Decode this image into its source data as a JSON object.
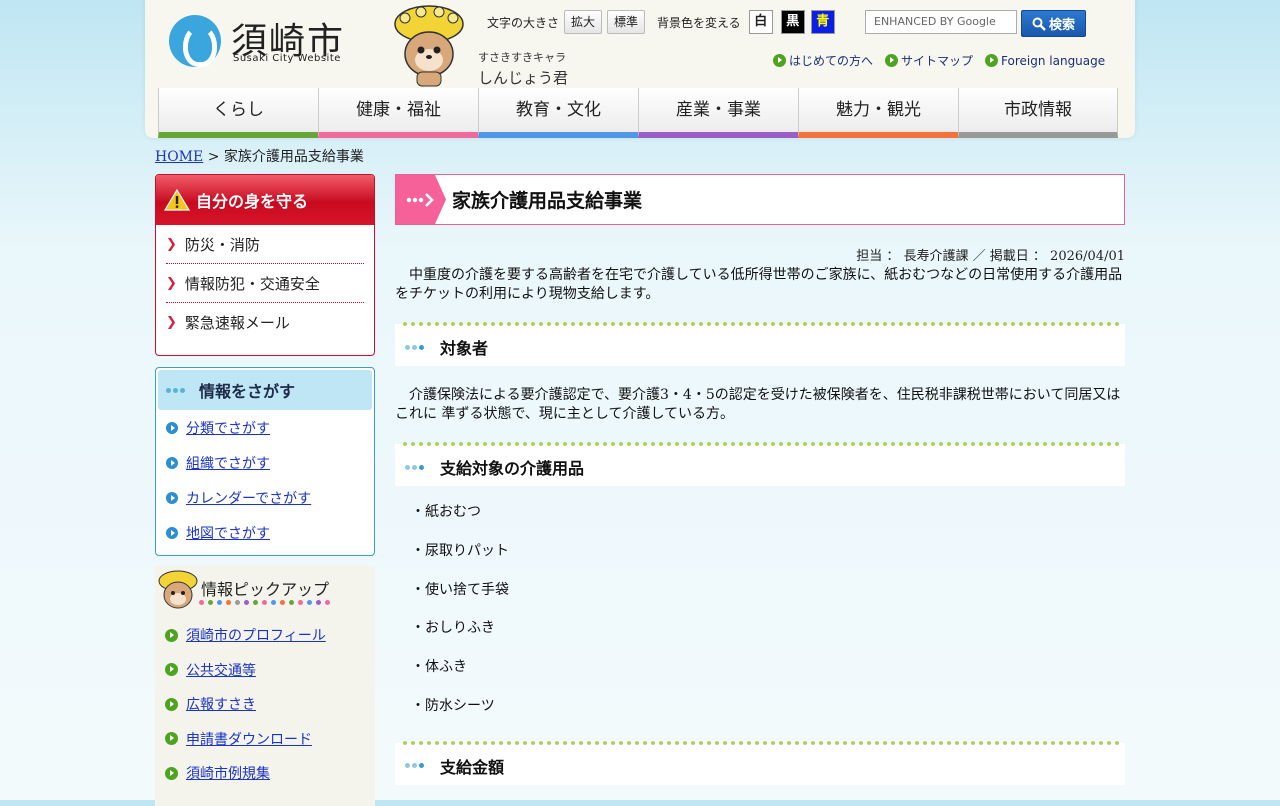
{
  "header": {
    "logo_text": "須崎市",
    "logo_sub": "Susaki City Website",
    "mascot_sub": "すさきすきキャラ",
    "mascot_name": "しんじょう君",
    "font_size_label": "文字の大きさ",
    "font_enlarge": "拡大",
    "font_standard": "標準",
    "bg_color_label": "背景色を変える",
    "bg_white": "白",
    "bg_black": "黒",
    "bg_blue": "青",
    "search_placeholder": "ENHANCED BY Google",
    "search_button": "検索",
    "sublinks": [
      "はじめての方へ",
      "サイトマップ",
      "Foreign language"
    ]
  },
  "nav": [
    {
      "label": "くらし",
      "color": "#66a638"
    },
    {
      "label": "健康・福祉",
      "color": "#f26a9c"
    },
    {
      "label": "教育・文化",
      "color": "#4f98e8"
    },
    {
      "label": "産業・事業",
      "color": "#9b5ec6"
    },
    {
      "label": "魅力・観光",
      "color": "#f5733a"
    },
    {
      "label": "市政情報",
      "color": "#999999"
    }
  ],
  "breadcrumb": {
    "home": "HOME",
    "separator": " > ",
    "current": "家族介護用品支給事業"
  },
  "sidebar": {
    "protect": {
      "title": "自分の身を守る",
      "items": [
        "防災・消防",
        "情報防犯・交通安全",
        "緊急速報メール"
      ]
    },
    "search": {
      "title": "情報をさがす",
      "items": [
        "分類でさがす",
        "組織でさがす",
        "カレンダーでさがす",
        "地図でさがす"
      ]
    },
    "pickup": {
      "title": "情報ピックアップ",
      "items": [
        "須崎市のプロフィール",
        "公共交通等",
        "広報すさき",
        "申請書ダウンロード",
        "須崎市例規集"
      ]
    }
  },
  "main": {
    "title": "家族介護用品支給事業",
    "meta": "担当 ： 長寿介護課 ／ 掲載日 ： 2026/04/01",
    "intro": "中重度の介護を要する高齢者を在宅で介護している低所得世帯のご家族に、紙おむつなどの日常使用する介護用品をチケットの利用により現物支給します。",
    "sections": [
      {
        "heading": "対象者",
        "text": "介護保険法による要介護認定で、要介護3・4・5の認定を受けた被保険者を、住民税非課税世帯において同居又はこれに 準ずる状態で、現に主として介護している方。"
      },
      {
        "heading": "支給対象の介護用品",
        "items": [
          "・紙おむつ",
          "・尿取りパット",
          "・使い捨て手袋",
          "・おしりふき",
          "・体ふき",
          "・防水シーツ"
        ]
      },
      {
        "heading": "支給金額"
      }
    ]
  },
  "colors": {
    "protect_red": "#c8102e",
    "search_blue": "#3aa0c6",
    "title_pink": "#f7619a",
    "link_blue": "#1a33c8"
  }
}
